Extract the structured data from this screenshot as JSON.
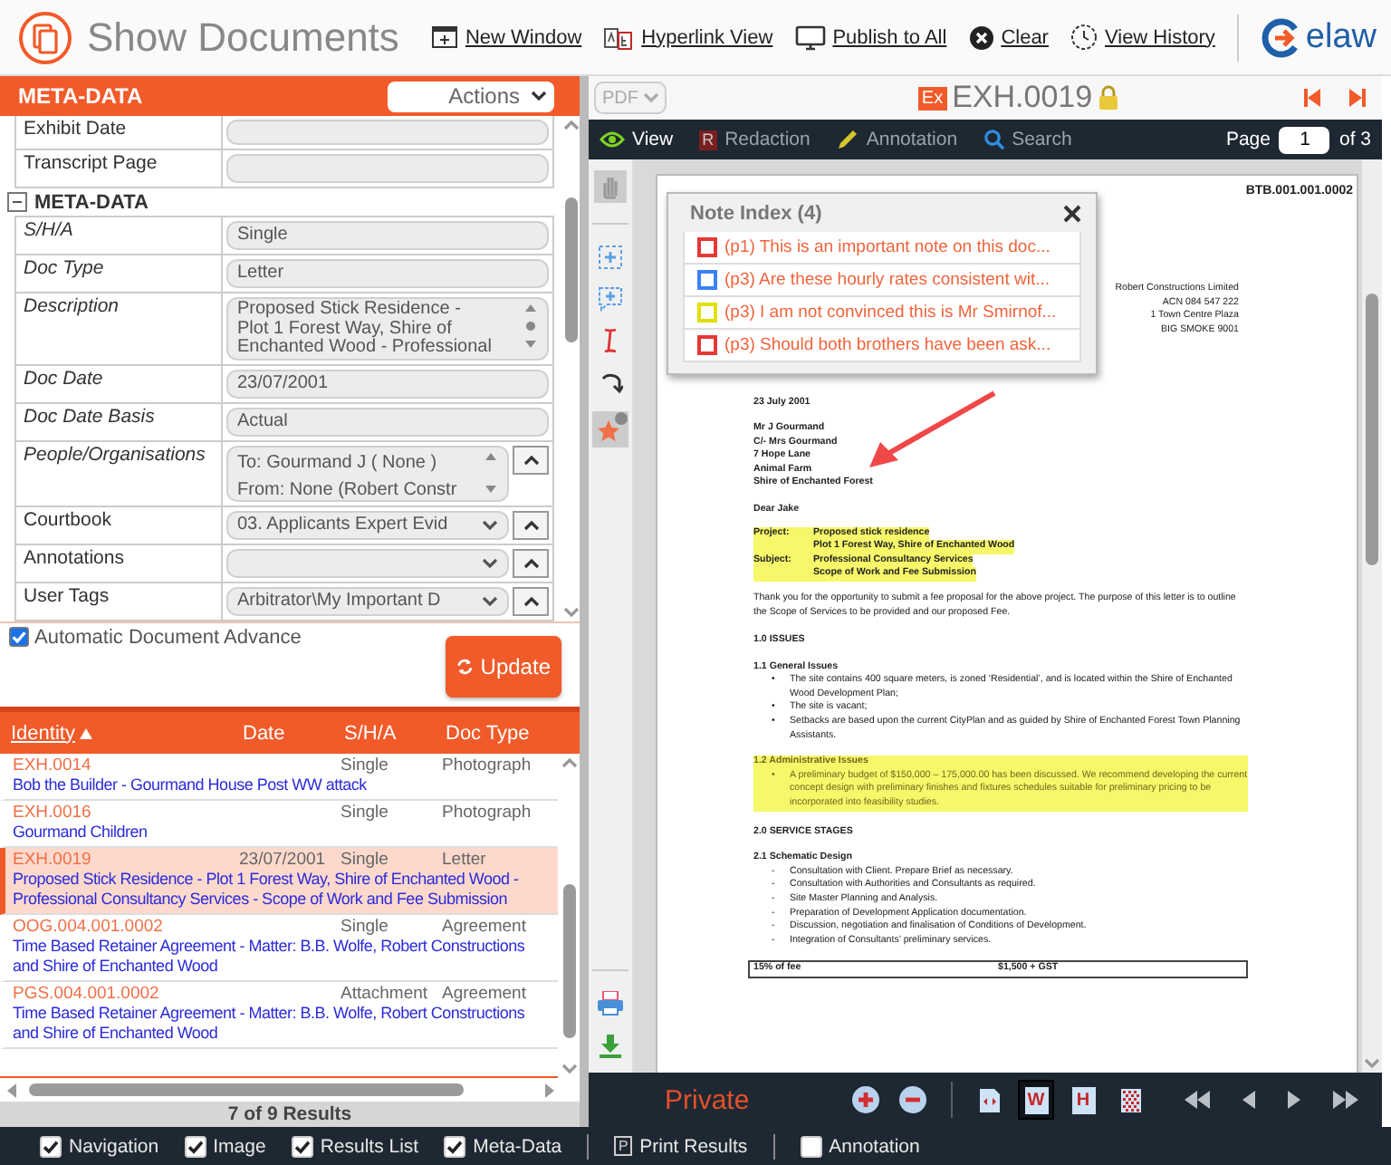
{
  "header": {
    "title": "Show Documents",
    "actions": [
      {
        "kind": "window",
        "label": "New Window"
      },
      {
        "kind": "hyperlink",
        "label": "Hyperlink View"
      },
      {
        "kind": "publish",
        "label": "Publish to All"
      },
      {
        "kind": "clear",
        "label": "Clear"
      },
      {
        "kind": "history",
        "label": "View History"
      }
    ],
    "logo": "elaw"
  },
  "metadata": {
    "title": "META-DATA",
    "actions_label": "Actions",
    "top_rows": [
      {
        "label": "Exhibit Date"
      },
      {
        "label": "Transcript Page"
      }
    ],
    "section": {
      "title": "META-DATA",
      "expanded": true,
      "rows": [
        {
          "label": "S/H/A",
          "italic": true,
          "kind": "text",
          "lines": [
            "Single"
          ]
        },
        {
          "label": "Doc Type",
          "italic": true,
          "kind": "text",
          "lines": [
            "Letter"
          ]
        },
        {
          "label": "Description",
          "italic": true,
          "kind": "multiline",
          "lines": [
            "Proposed Stick Residence -",
            "Plot 1 Forest Way, Shire of",
            "Enchanted Wood - Professional"
          ]
        },
        {
          "label": "Doc Date",
          "italic": true,
          "kind": "text",
          "lines": [
            "23/07/2001"
          ]
        },
        {
          "label": "Doc Date Basis",
          "italic": true,
          "kind": "text",
          "lines": [
            "Actual"
          ]
        },
        {
          "label": "People/Organisations",
          "italic": true,
          "kind": "list",
          "lines": [
            "To: Gourmand J ( None )",
            "From: None (Robert Constr"
          ]
        },
        {
          "label": "Courtbook",
          "italic": false,
          "kind": "select",
          "lines": [
            "03. Applicants Expert Evid"
          ]
        },
        {
          "label": "Annotations",
          "italic": false,
          "kind": "select",
          "lines": []
        },
        {
          "label": "User Tags",
          "italic": false,
          "kind": "select",
          "lines": [
            "Arbitrator\\My Important D"
          ]
        }
      ]
    },
    "auto_advance": {
      "label": "Automatic Document Advance",
      "checked": true
    },
    "update_button": "Update"
  },
  "results": {
    "columns": [
      {
        "label": "Identity",
        "sorted": true
      },
      {
        "label": "Date",
        "sorted": false
      },
      {
        "label": "S/H/A",
        "sorted": false
      },
      {
        "label": "Doc Type",
        "sorted": false
      }
    ],
    "rows": [
      {
        "identity": "EXH.0014",
        "sha": "Single",
        "doc_type": "Photograph",
        "title": "Bob the Builder - Gourmand House Post WW attack",
        "selected": false
      },
      {
        "identity": "EXH.0016",
        "sha": "Single",
        "doc_type": "Photograph",
        "title": "Gourmand Children",
        "selected": false
      },
      {
        "identity": "EXH.0019",
        "date": "23/07/2001",
        "sha": "Single",
        "doc_type": "Letter",
        "title": "Proposed Stick Residence - Plot 1 Forest Way, Shire of Enchanted Wood - Professional Consultancy Services - Scope of Work and Fee Submission",
        "selected": true
      },
      {
        "identity": "OOG.004.001.0002",
        "sha": "Single",
        "doc_type": "Agreement",
        "title": "Time Based Retainer Agreement - Matter: B.B. Wolfe, Robert Constructions and Shire of Enchanted Wood",
        "selected": false
      },
      {
        "identity": "PGS.004.001.0002",
        "sha": "Attachment",
        "doc_type": "Agreement",
        "title": "Time Based Retainer Agreement - Matter: B.B. Wolfe, Robert Constructions and Shire of Enchanted Wood",
        "selected": false
      }
    ],
    "footer": "7 of 9 Results"
  },
  "viewer": {
    "format": "PDF",
    "badge": "Ex",
    "title": "EXH.0019",
    "tools": [
      {
        "kind": "view",
        "label": "View",
        "selected": true
      },
      {
        "kind": "redaction",
        "label": "Redaction",
        "letter": "R",
        "selected": false
      },
      {
        "kind": "annotation",
        "label": "Annotation",
        "selected": false
      },
      {
        "kind": "search",
        "label": "Search",
        "selected": false
      }
    ],
    "page_label": "Page",
    "page": "1",
    "page_total": "of 3",
    "status": "Private",
    "view_modes": [
      {
        "kind": "fit",
        "selected": false
      },
      {
        "kind": "width",
        "letter": "W",
        "selected": true
      },
      {
        "kind": "height",
        "letter": "H",
        "selected": false
      },
      {
        "kind": "pattern",
        "selected": false
      }
    ]
  },
  "note_index": {
    "title": "Note Index (4)",
    "notes": [
      {
        "text": "(p1) This is an important note on this doc...",
        "color": "#e53935"
      },
      {
        "text": "(p3) Are these hourly rates consistent wit...",
        "color": "#3b82f6"
      },
      {
        "text": "(p3) I am not convinced this is Mr Smirnof...",
        "color": "#e0e000"
      },
      {
        "text": "(p3) Should both brothers have been ask...",
        "color": "#e53935"
      }
    ]
  },
  "document": {
    "reference": "BTB.001.001.0002",
    "sender_lines": [
      "Robert Constructions Limited",
      "ACN 084 547 222",
      "1 Town Centre Plaza",
      "BIG SMOKE 9001"
    ],
    "date": "23 July 2001",
    "address_lines": [
      "Mr J Gourmand",
      "C/- Mrs Gourmand",
      "7 Hope Lane",
      "Animal Farm",
      "Shire of Enchanted Forest"
    ],
    "salutation": "Dear Jake",
    "subject_rows": [
      {
        "label": "Project:",
        "value": "Proposed stick residence",
        "highlighted": true
      },
      {
        "value": "Plot 1 Forest Way, Shire of Enchanted Wood",
        "highlighted": true
      },
      {
        "label": "Subject:",
        "value": "Professional Consultancy Services",
        "highlighted": true
      },
      {
        "value": "Scope of Work and Fee Submission",
        "highlighted": true
      }
    ],
    "blocks": [
      {
        "kind": "para",
        "text": "Thank you for the opportunity to submit a fee proposal for the above project. The purpose of this letter is to outline the Scope of Services to be provided and our proposed Fee.",
        "highlighted": false
      },
      {
        "kind": "heading",
        "text": "1.0  ISSUES",
        "highlighted": false
      },
      {
        "kind": "subheading",
        "text": "1.1   General Issues",
        "highlighted": false
      },
      {
        "kind": "bullet",
        "marker": "•",
        "text": "The site contains 400 square meters, is zoned ‘Residential’, and is located within the Shire of Enchanted Wood Development Plan;",
        "highlighted": false
      },
      {
        "kind": "bullet",
        "marker": "•",
        "text": "The site is vacant;",
        "highlighted": false
      },
      {
        "kind": "bullet",
        "marker": "•",
        "text": "Setbacks are based upon the current CityPlan and as guided by Shire of Enchanted Forest Town Planning Assistants.",
        "highlighted": false
      },
      {
        "kind": "subheading",
        "text": "1.2   Administrative Issues",
        "highlighted": true
      },
      {
        "kind": "bullet",
        "marker": "•",
        "text": "A preliminary budget of $150,000 – 175,000.00 has been discussed. We recommend developing the current concept design with preliminary finishes and fixtures schedules suitable for preliminary pricing to be incorporated into feasibility studies.",
        "highlighted": true
      },
      {
        "kind": "heading",
        "text": "2.0  SERVICE STAGES",
        "highlighted": false
      },
      {
        "kind": "subheading",
        "text": "2.1   Schematic Design",
        "highlighted": false
      },
      {
        "kind": "dash",
        "marker": "-",
        "text": "Consultation with Client. Prepare Brief as necessary.",
        "highlighted": false
      },
      {
        "kind": "dash",
        "marker": "-",
        "text": "Consultation with Authorities and Consultants as required.",
        "highlighted": false
      },
      {
        "kind": "dash",
        "marker": "-",
        "text": "Site Master Planning and Analysis.",
        "highlighted": false
      },
      {
        "kind": "dash",
        "marker": "-",
        "text": "Preparation of Development Application documentation.",
        "highlighted": false
      },
      {
        "kind": "dash",
        "marker": "-",
        "text": "Discussion, negotiation and finalisation of Conditions of Development.",
        "highlighted": false
      },
      {
        "kind": "dash",
        "marker": "-",
        "text": "Integration of Consultants’ preliminary services.",
        "highlighted": false
      }
    ],
    "fee_row": [
      "15% of fee",
      "$1,500 + GST"
    ]
  },
  "bottom_bar": [
    {
      "kind": "checkbox",
      "label": "Navigation",
      "checked": true
    },
    {
      "kind": "checkbox",
      "label": "Image",
      "checked": true
    },
    {
      "kind": "checkbox",
      "label": "Results List",
      "checked": true
    },
    {
      "kind": "checkbox",
      "label": "Meta-Data",
      "checked": true
    },
    {
      "kind": "button",
      "label": "Print Results",
      "letter": "P"
    },
    {
      "kind": "checkbox",
      "label": "Annotation",
      "checked": false
    }
  ]
}
